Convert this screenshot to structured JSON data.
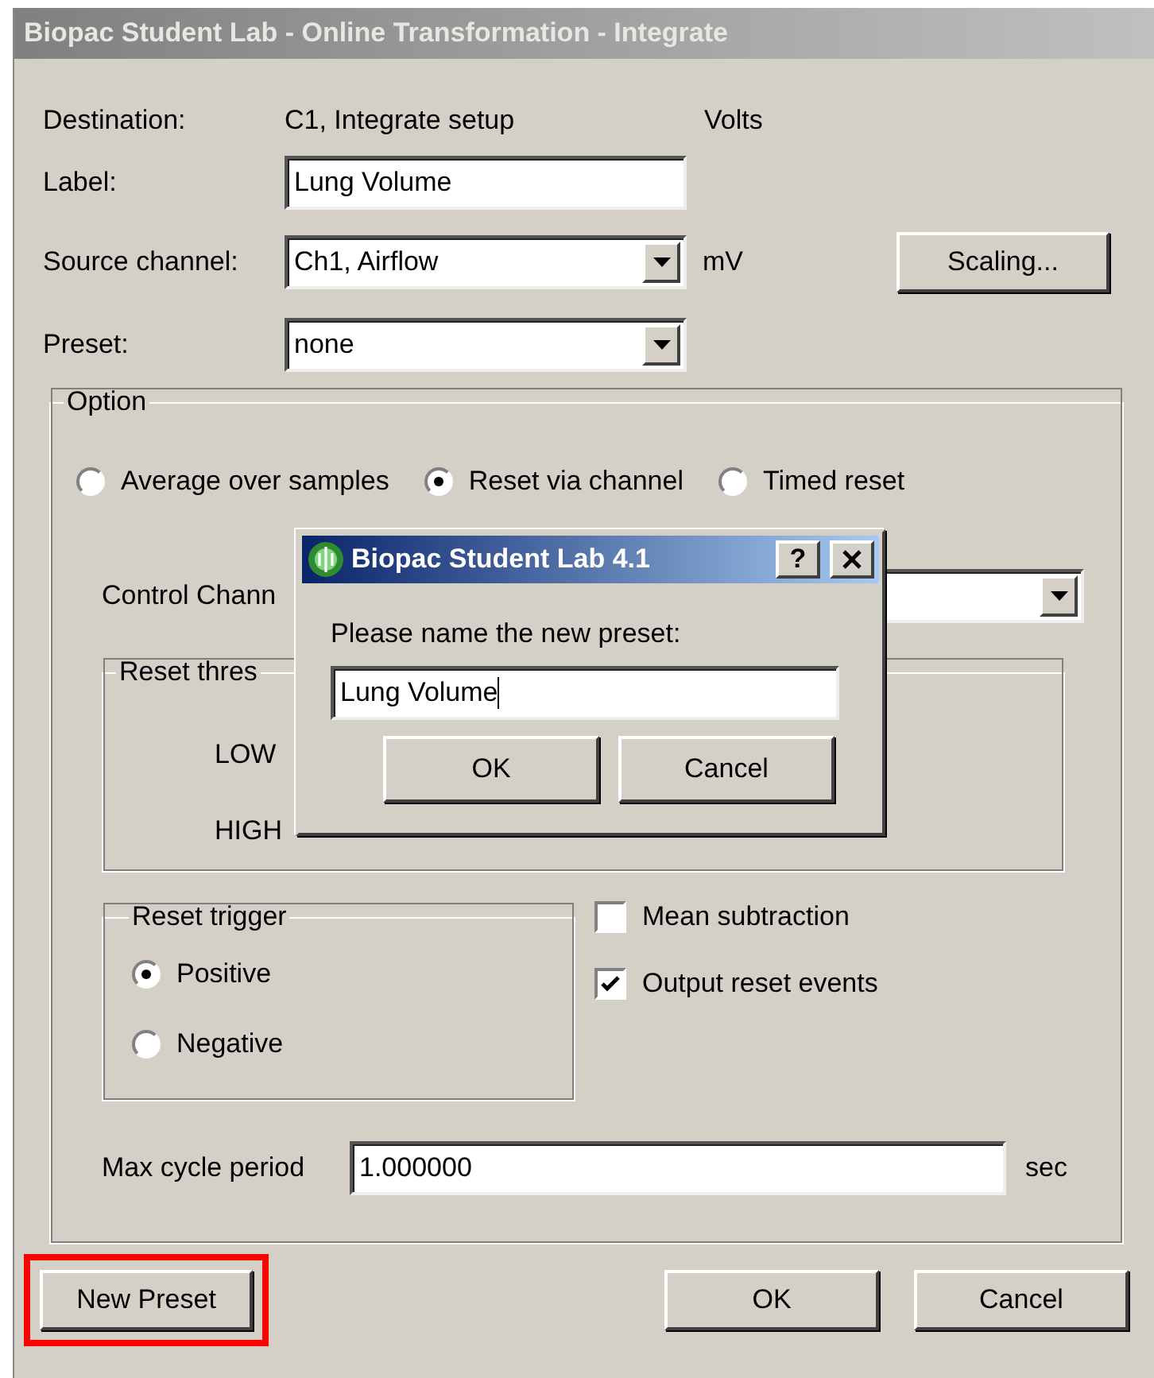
{
  "window": {
    "title": "Biopac Student Lab - Online Transformation - Integrate",
    "active": false
  },
  "form": {
    "destination": {
      "label": "Destination:",
      "value": "C1, Integrate setup",
      "unit": "Volts"
    },
    "label_field": {
      "label": "Label:",
      "value": "Lung Volume"
    },
    "source": {
      "label": "Source channel:",
      "value": "Ch1, Airflow",
      "unit": "mV"
    },
    "scaling_button": "Scaling...",
    "preset": {
      "label": "Preset:",
      "value": "none"
    }
  },
  "option_group": {
    "title": "Option",
    "modes": [
      {
        "label": "Average over samples",
        "selected": false
      },
      {
        "label": "Reset via channel",
        "selected": true
      },
      {
        "label": "Timed reset",
        "selected": false
      }
    ],
    "control_channel": {
      "label": "Control Chann"
    },
    "reset_threshold": {
      "title": "Reset thres",
      "levels": [
        "LOW",
        "HIGH"
      ]
    },
    "reset_trigger": {
      "title": "Reset trigger",
      "options": [
        {
          "label": "Positive",
          "selected": true
        },
        {
          "label": "Negative",
          "selected": false
        }
      ]
    },
    "checkboxes": [
      {
        "label": "Mean subtraction",
        "checked": false
      },
      {
        "label": "Output reset events",
        "checked": true
      }
    ],
    "max_cycle": {
      "label": "Max cycle period",
      "value": "1.000000",
      "unit": "sec"
    }
  },
  "buttons": [
    {
      "label": "New Preset",
      "highlighted": true
    },
    {
      "label": "OK",
      "highlighted": false
    },
    {
      "label": "Cancel",
      "highlighted": false
    }
  ],
  "modal": {
    "title": "Biopac Student Lab 4.1",
    "help": "?",
    "prompt": "Please name the new preset:",
    "value": "Lung Volume",
    "buttons": [
      "OK",
      "Cancel"
    ]
  }
}
